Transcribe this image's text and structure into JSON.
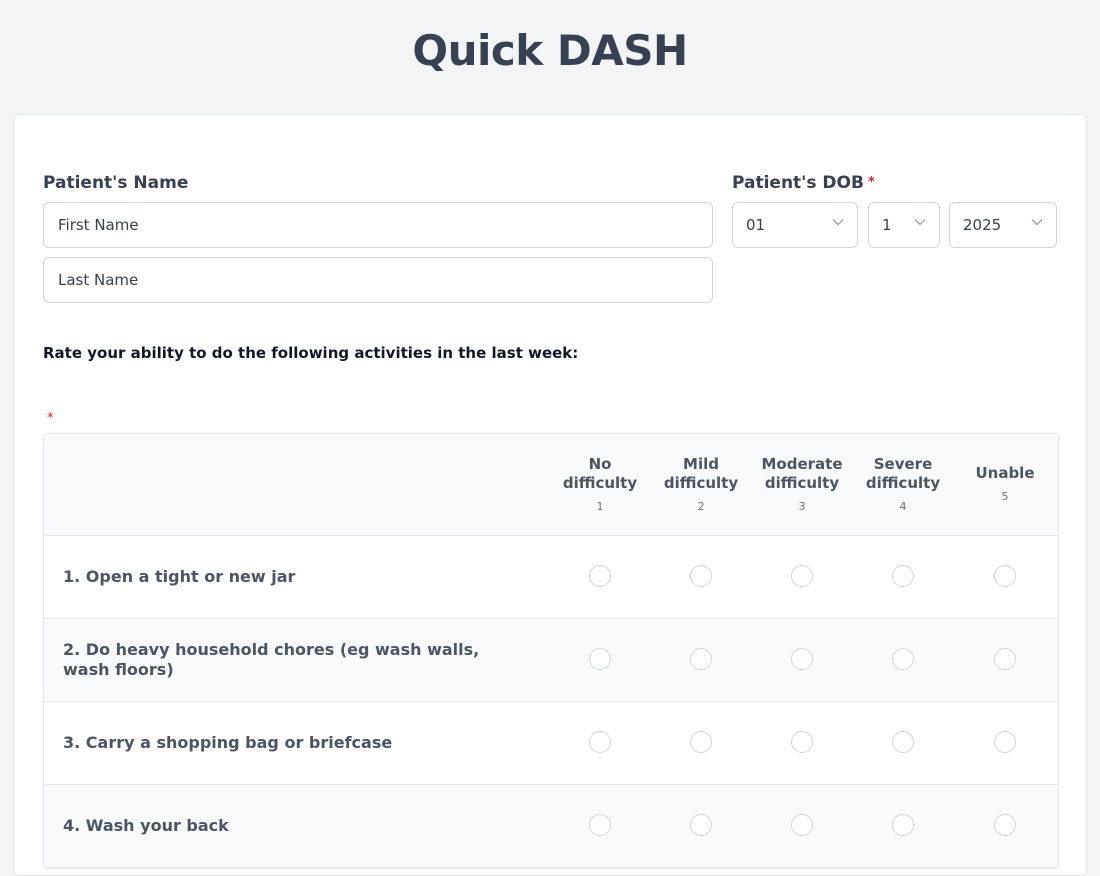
{
  "page": {
    "title": "Quick DASH"
  },
  "form": {
    "name_label": "Patient's Name",
    "first_name": {
      "placeholder": "First Name",
      "value": ""
    },
    "last_name": {
      "placeholder": "Last Name",
      "value": ""
    },
    "dob_label": "Patient's DOB",
    "required_mark": "*",
    "dob_month": "01",
    "dob_day": "1",
    "dob_year": "2025"
  },
  "matrix": {
    "instructions": "Rate your ability to do the following activities in the last week:",
    "required_mark": "*",
    "columns": [
      {
        "label": "No difficulty",
        "number": "1"
      },
      {
        "label": "Mild difficulty",
        "number": "2"
      },
      {
        "label": "Moderate difficulty",
        "number": "3"
      },
      {
        "label": "Severe difficulty",
        "number": "4"
      },
      {
        "label": "Unable",
        "number": "5"
      }
    ],
    "rows": [
      {
        "label": "1. Open a tight or new jar"
      },
      {
        "label": "2. Do heavy household chores (eg wash walls, wash floors)"
      },
      {
        "label": "3. Carry a shopping bag or briefcase"
      },
      {
        "label": "4. Wash your back"
      }
    ]
  },
  "icons": {
    "select_chevron": "chevron-down-icon"
  },
  "colors": {
    "background": "#f3f4f6",
    "card": "#ffffff",
    "border": "#d1d5db",
    "required": "#dc2626",
    "text": "#374151"
  }
}
